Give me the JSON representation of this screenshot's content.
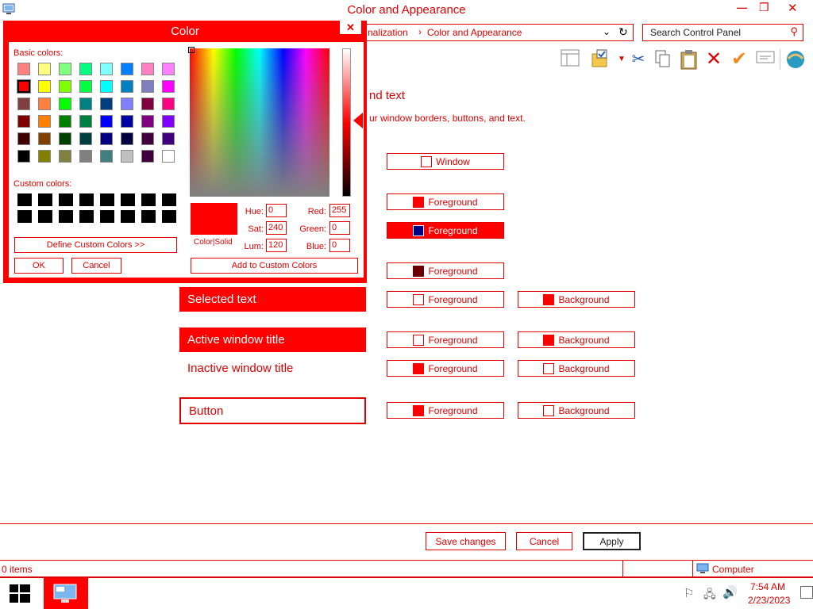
{
  "window": {
    "title": "Color and Appearance",
    "controls": {
      "minimize": "—",
      "restore": "❐",
      "close": "✕"
    }
  },
  "address": {
    "segments": [
      "nalization",
      "Color and Appearance"
    ],
    "separator": "›"
  },
  "search": {
    "placeholder": "Search Control Panel"
  },
  "heading": {
    "title": "nd text",
    "subtitle": "ur window borders, buttons, and text."
  },
  "elements": {
    "window": {
      "label": "Window",
      "swatch": "#ffffff"
    },
    "row1_fg": {
      "label": "Foreground",
      "swatch": "#ff0000"
    },
    "row2_fg": {
      "label": "Foreground",
      "swatch": "#00008b"
    },
    "row3_fg": {
      "label": "Foreground",
      "swatch": "#6b0000"
    },
    "selected": {
      "sample": "Selected text",
      "fg": "Foreground",
      "bg": "Background",
      "fg_swatch": "#ffffff",
      "bg_swatch": "#ff0000"
    },
    "active": {
      "sample": "Active window title",
      "fg": "Foreground",
      "bg": "Background",
      "fg_swatch": "#ffffff",
      "bg_swatch": "#ff0000"
    },
    "inactive": {
      "sample": "Inactive window title",
      "fg": "Foreground",
      "bg": "Background",
      "fg_swatch": "#ff0000",
      "bg_swatch": "#ffffff"
    },
    "button": {
      "sample": "Button",
      "fg": "Foreground",
      "bg": "Background",
      "fg_swatch": "#ff0000",
      "bg_swatch": "#ffffff"
    }
  },
  "actions": {
    "save": "Save changes",
    "cancel": "Cancel",
    "apply": "Apply"
  },
  "status": {
    "items": "0 items",
    "location": "Computer"
  },
  "taskbar": {
    "time": "7:54 AM",
    "date": "2/23/2023"
  },
  "dialog": {
    "title": "Color",
    "close": "✕",
    "basic_label": "Basic colors:",
    "custom_label": "Custom colors:",
    "define_btn": "Define Custom Colors >>",
    "ok": "OK",
    "cancel": "Cancel",
    "add_btn": "Add to Custom Colors",
    "color_solid": "Color|Solid",
    "fields": {
      "hue_label": "Hue:",
      "hue": "0",
      "sat_label": "Sat:",
      "sat": "240",
      "lum_label": "Lum:",
      "lum": "120",
      "red_label": "Red:",
      "red": "255",
      "green_label": "Green:",
      "green": "0",
      "blue_label": "Blue:",
      "blue": "0"
    },
    "basic_colors": [
      [
        "#ff8080",
        "#ffff80",
        "#80ff80",
        "#00ff80",
        "#80ffff",
        "#0080ff",
        "#ff80c0",
        "#ff80ff"
      ],
      [
        "#ff0000",
        "#ffff00",
        "#80ff00",
        "#00ff40",
        "#00ffff",
        "#0080c0",
        "#8080c0",
        "#ff00ff"
      ],
      [
        "#804040",
        "#ff8040",
        "#00ff00",
        "#008080",
        "#004080",
        "#8080ff",
        "#800040",
        "#ff0080"
      ],
      [
        "#800000",
        "#ff8000",
        "#008000",
        "#008040",
        "#0000ff",
        "#0000a0",
        "#800080",
        "#8000ff"
      ],
      [
        "#400000",
        "#804000",
        "#004000",
        "#004040",
        "#000080",
        "#000040",
        "#400040",
        "#400080"
      ],
      [
        "#000000",
        "#808000",
        "#808040",
        "#808080",
        "#408080",
        "#c0c0c0",
        "#400040",
        "#ffffff"
      ]
    ],
    "selected_color": "#ff0000"
  }
}
